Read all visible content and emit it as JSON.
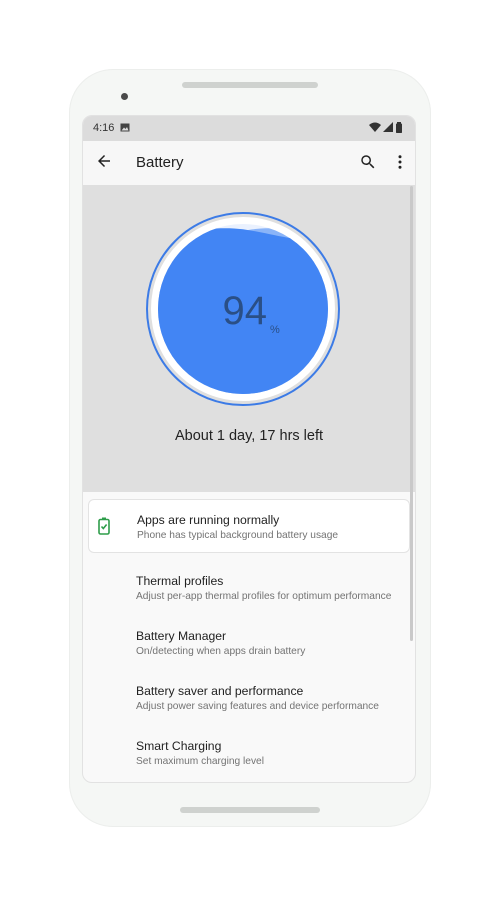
{
  "status_bar": {
    "time": "4:16"
  },
  "app_bar": {
    "title": "Battery"
  },
  "battery": {
    "level": 94,
    "percent_symbol": "%",
    "time_left": "About 1 day, 17 hrs left"
  },
  "list": [
    {
      "title": "Apps are running normally",
      "subtitle": "Phone has typical background battery usage"
    },
    {
      "title": "Thermal profiles",
      "subtitle": "Adjust per-app thermal profiles for optimum performance"
    },
    {
      "title": "Battery Manager",
      "subtitle": "On/detecting when apps drain battery"
    },
    {
      "title": "Battery saver and performance",
      "subtitle": "Adjust power saving features and device performance"
    },
    {
      "title": "Smart Charging",
      "subtitle": "Set maximum charging level"
    }
  ],
  "colors": {
    "accent": "#4285f4",
    "accent_light": "#8ab4f8",
    "ok_green": "#2e9d4a"
  }
}
